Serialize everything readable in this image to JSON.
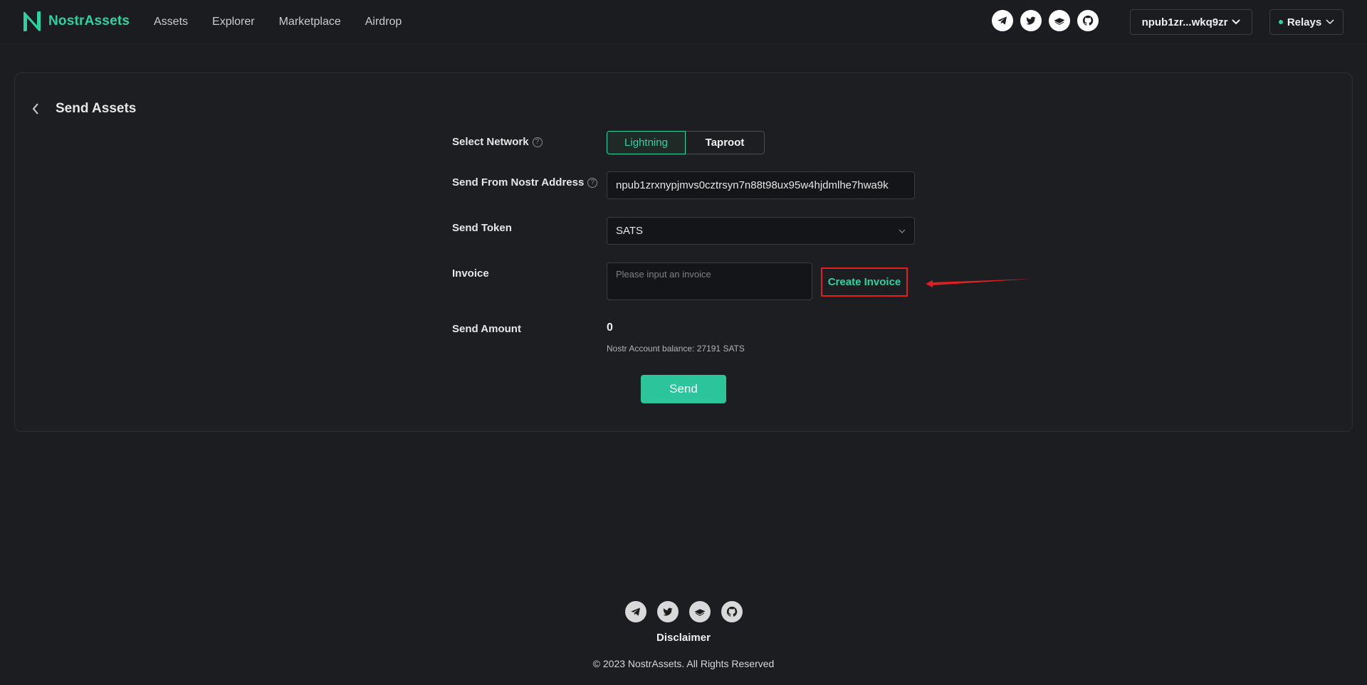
{
  "header": {
    "brand": "NostrAssets",
    "nav": [
      "Assets",
      "Explorer",
      "Marketplace",
      "Airdrop"
    ],
    "social_icons": [
      "telegram-icon",
      "twitter-icon",
      "gitbook-icon",
      "github-icon"
    ],
    "wallet_label": "npub1zr...wkq9zr",
    "relays_label": "Relays"
  },
  "page": {
    "title": "Send Assets",
    "select_network_label": "Select Network",
    "network_options": [
      "Lightning",
      "Taproot"
    ],
    "selected_network": "Lightning",
    "send_from_label": "Send From Nostr Address",
    "send_from_value": "npub1zrxnypjmvs0cztrsyn7n88t98ux95w4hjdmlhe7hwa9k",
    "send_token_label": "Send Token",
    "send_token_value": "SATS",
    "invoice_label": "Invoice",
    "invoice_placeholder": "Please input an invoice",
    "create_invoice_label": "Create Invoice",
    "send_amount_label": "Send Amount",
    "send_amount_value": "0",
    "balance_text": "Nostr Account balance: 27191 SATS",
    "send_button": "Send"
  },
  "footer": {
    "disclaimer": "Disclaimer",
    "copyright": "© 2023 NostrAssets. All Rights Reserved"
  },
  "colors": {
    "accent": "#2bd3a3",
    "background": "#1b1d21",
    "highlight": "#e02020"
  }
}
